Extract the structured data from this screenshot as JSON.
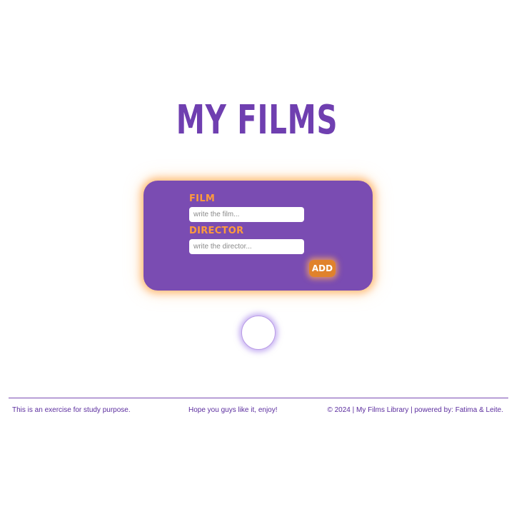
{
  "header": {
    "title": "MY FILMS"
  },
  "form": {
    "film_label": "FILM",
    "film_placeholder": "write the film...",
    "film_value": "",
    "director_label": "DIRECTOR",
    "director_placeholder": "write the director...",
    "director_value": "",
    "add_label": "ADD"
  },
  "footer": {
    "left_text": "This is an exercise for study purpose.",
    "center_text": "Hope you guys like it, enjoy!",
    "right_text": "© 2024 | My Films Library | powered by: Fatima & Leite."
  },
  "colors": {
    "primary": "#7a4cb2",
    "title": "#6f3fb0",
    "accent": "#ff9a3c",
    "button": "#e0822c",
    "footer_text": "#5b2d9e"
  }
}
